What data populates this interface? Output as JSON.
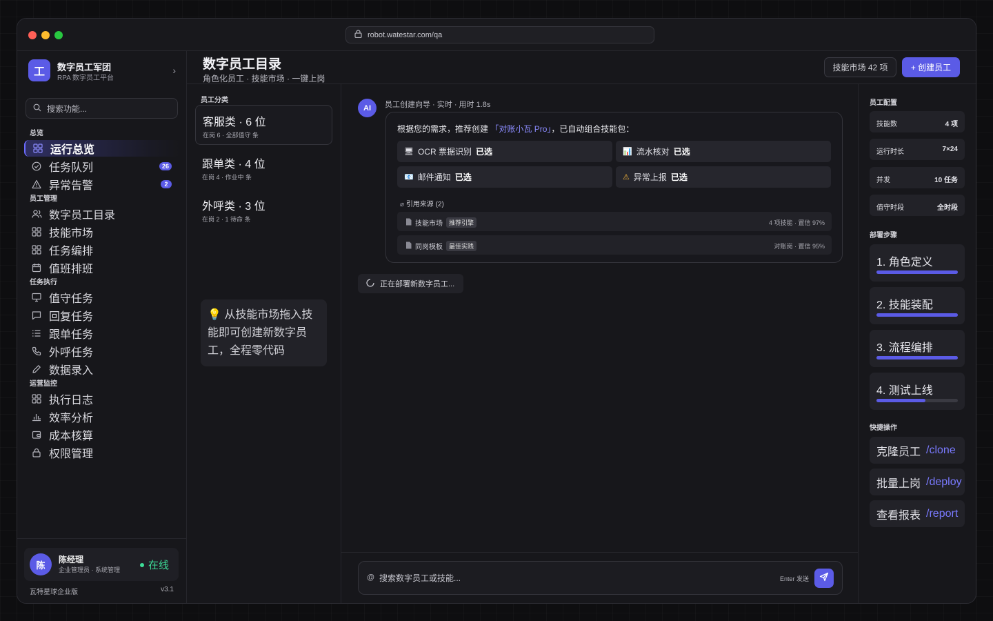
{
  "browser": {
    "url": "robot.watestar.com/qa"
  },
  "brand": {
    "logo_char": "工",
    "title": "数字员工军团",
    "subtitle": "RPA 数字员工平台"
  },
  "search": {
    "placeholder": "搜索功能..."
  },
  "sidebar": {
    "sections": [
      {
        "label": "总览",
        "items": [
          {
            "label": "运行总览",
            "icon": "grid-icon",
            "active": true
          },
          {
            "label": "任务队列",
            "icon": "check-circle-icon",
            "badge": "26"
          },
          {
            "label": "异常告警",
            "icon": "warning-icon",
            "badge": "2"
          }
        ]
      },
      {
        "label": "员工管理",
        "items": [
          {
            "label": "数字员工目录",
            "icon": "users-icon"
          },
          {
            "label": "技能市场",
            "icon": "grid-icon"
          },
          {
            "label": "任务编排",
            "icon": "grid-icon"
          },
          {
            "label": "值班排班",
            "icon": "calendar-icon"
          }
        ]
      },
      {
        "label": "任务执行",
        "items": [
          {
            "label": "值守任务",
            "icon": "monitor-icon"
          },
          {
            "label": "回复任务",
            "icon": "message-icon"
          },
          {
            "label": "跟单任务",
            "icon": "list-icon"
          },
          {
            "label": "外呼任务",
            "icon": "phone-icon"
          },
          {
            "label": "数据录入",
            "icon": "pencil-icon"
          }
        ]
      },
      {
        "label": "运营监控",
        "items": [
          {
            "label": "执行日志",
            "icon": "grid-icon"
          },
          {
            "label": "效率分析",
            "icon": "bar-chart-icon"
          },
          {
            "label": "成本核算",
            "icon": "wallet-icon"
          },
          {
            "label": "权限管理",
            "icon": "lock-icon"
          }
        ]
      }
    ]
  },
  "user": {
    "avatar": "陈",
    "name": "陈经理",
    "role": "企业管理员 · 系统管理",
    "status": "在线"
  },
  "footer": {
    "edition": "瓦特星球企业版",
    "version": "v3.1"
  },
  "header": {
    "title": "数字员工目录",
    "subtitle": "角色化员工 · 技能市场 · 一键上岗",
    "market_button": "技能市场 42 项",
    "create_button": "+ 创建员工"
  },
  "categories": {
    "label": "员工分类",
    "items": [
      {
        "name": "客服类 · 6 位",
        "meta": "在岗 6 · 全部值守 条"
      },
      {
        "name": "跟单类 · 4 位",
        "meta": "在岗 4 · 作业中 条"
      },
      {
        "name": "外呼类 · 3 位",
        "meta": "在岗 2 · 1 待命 条"
      }
    ],
    "tip": "💡 从技能市场拖入技能即可创建新数字员工，全程零代码"
  },
  "chat": {
    "ai_avatar": "AI",
    "meta": "员工创建向导 · 实时 · 用时 1.8s",
    "message_prefix": "根据您的需求，推荐创建",
    "message_highlight": "「对账小瓦 Pro」",
    "message_suffix": "，已自动组合技能包：",
    "skills": [
      {
        "icon": "🖥",
        "name": "OCR 票据识别",
        "state": "已选"
      },
      {
        "icon": "📊",
        "name": "流水核对",
        "state": "已选"
      },
      {
        "icon": "📧",
        "name": "邮件通知",
        "state": "已选"
      },
      {
        "icon": "⚠",
        "name": "异常上报",
        "state": "已选"
      }
    ],
    "refs_label": "引用来源 (2)",
    "refs": [
      {
        "name": "技能市场",
        "tag": "推荐引擎",
        "detail": "4 项技能 · 置信 97%"
      },
      {
        "name": "同岗模板",
        "tag": "最佳实践",
        "detail": "对账岗 · 置信 95%"
      }
    ],
    "deploy_status": "正在部署新数字员工...",
    "input_prefix": "@",
    "input_placeholder": "搜索数字员工或技能...",
    "input_hint": "Enter 发送"
  },
  "config": {
    "label": "员工配置",
    "rows": [
      {
        "key": "技能数",
        "value": "4 项"
      },
      {
        "key": "运行时长",
        "value": "7×24"
      },
      {
        "key": "并发",
        "value": "10 任务"
      },
      {
        "key": "值守时段",
        "value": "全时段"
      }
    ]
  },
  "steps": {
    "label": "部署步骤",
    "items": [
      {
        "label": "1. 角色定义",
        "progress": 1.0
      },
      {
        "label": "2. 技能装配",
        "progress": 1.0
      },
      {
        "label": "3. 流程编排",
        "progress": 1.0
      },
      {
        "label": "4. 测试上线",
        "progress": 0.6
      }
    ]
  },
  "quick_actions": {
    "label": "快捷操作",
    "items": [
      {
        "label": "克隆员工",
        "cmd": "/clone"
      },
      {
        "label": "批量上岗",
        "cmd": "/deploy"
      },
      {
        "label": "查看报表",
        "cmd": "/report"
      }
    ]
  },
  "colors": {
    "accent": "#5b5be6",
    "online": "#3ddc97",
    "background": "#17171b"
  }
}
